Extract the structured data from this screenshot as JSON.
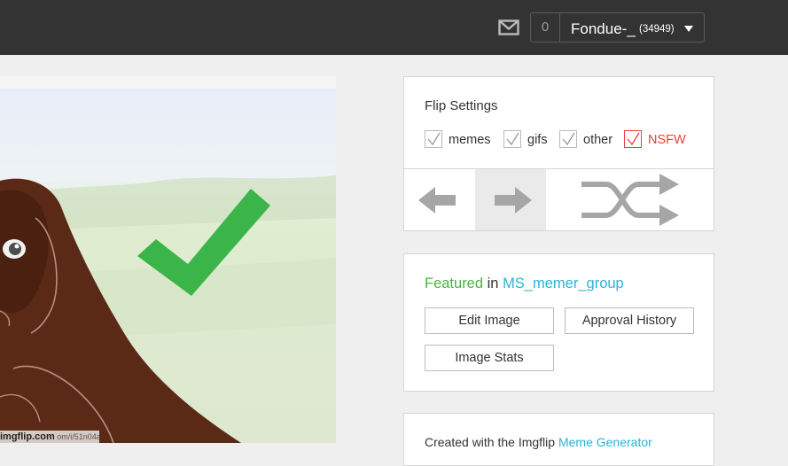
{
  "header": {
    "notification_count": "0",
    "username": "Fondue-_",
    "points": "(34949)",
    "icons": {
      "mail": "mail-icon",
      "caret": "caret-down-icon"
    }
  },
  "meme": {
    "watermark_logo": "imgflip.com",
    "watermark_url": "om/i/51n04a",
    "icons": {
      "checkmark": "green-checkmark"
    }
  },
  "flip_settings": {
    "title": "Flip Settings",
    "options": [
      {
        "label": "memes",
        "checked": true
      },
      {
        "label": "gifs",
        "checked": true
      },
      {
        "label": "other",
        "checked": true
      },
      {
        "label": "NSFW",
        "checked": true,
        "color": "#e8413b"
      }
    ],
    "icons": {
      "prev": "arrow-left-icon",
      "next": "arrow-right-icon",
      "random": "shuffle-icon"
    }
  },
  "featured": {
    "featured_word": "Featured",
    "in_word": "in",
    "group": "MS_memer_group",
    "edit_label": "Edit Image",
    "approval_label": "Approval History",
    "stats_label": "Image Stats"
  },
  "created": {
    "prefix": "Created with the Imgflip",
    "link": "Meme Generator"
  },
  "colors": {
    "topbar": "#333333",
    "featured_green": "#4ab43f",
    "link_blue": "#2ab3d8",
    "nsfw_red": "#e8413b"
  }
}
